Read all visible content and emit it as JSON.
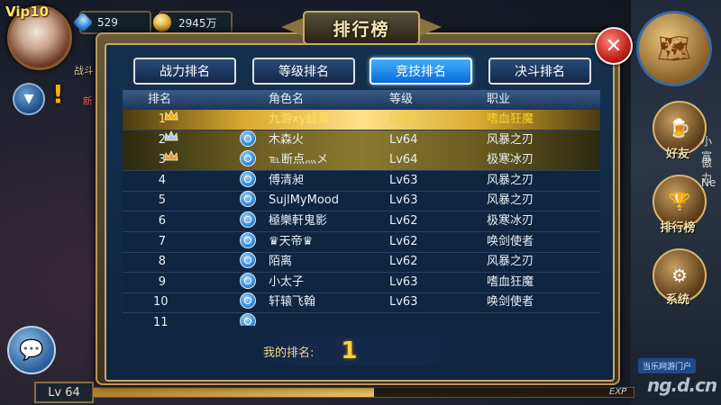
{
  "hud": {
    "vip": "Vip10",
    "diamonds": "529",
    "gold": "2945万",
    "level": "Lv 64",
    "exp_label": "EXP",
    "exp_progress": 0.52,
    "left_texts": [
      "战斗",
      "新"
    ]
  },
  "dialog": {
    "title": "排行榜",
    "tabs": [
      "战力排名",
      "等级排名",
      "竞技排名",
      "决斗排名"
    ],
    "active_tab": 2,
    "columns": [
      "排名",
      "角色名",
      "等级",
      "职业"
    ],
    "rows": [
      {
        "rank": "1",
        "name": "九游xy蛙哥",
        "level": "Lv64",
        "job": "嗜血狂魔"
      },
      {
        "rank": "2",
        "name": "木森火",
        "level": "Lv64",
        "job": "风暴之刃"
      },
      {
        "rank": "3",
        "name": "℡断点灬メ",
        "level": "Lv64",
        "job": "极寒冰刃"
      },
      {
        "rank": "4",
        "name": "傅清昶",
        "level": "Lv63",
        "job": "风暴之刃"
      },
      {
        "rank": "5",
        "name": "SujlMyMood",
        "level": "Lv63",
        "job": "风暴之刃"
      },
      {
        "rank": "6",
        "name": "極樂軒鬼影",
        "level": "Lv62",
        "job": "极寒冰刃"
      },
      {
        "rank": "7",
        "name": "♛天帝♛",
        "level": "Lv62",
        "job": "唤剑使者"
      },
      {
        "rank": "8",
        "name": "陌离",
        "level": "Lv62",
        "job": "风暴之刃"
      },
      {
        "rank": "9",
        "name": "小太子",
        "level": "Lv63",
        "job": "嗜血狂魔"
      },
      {
        "rank": "10",
        "name": "轩辕飞翰",
        "level": "Lv63",
        "job": "唤剑使者"
      },
      {
        "rank": "11",
        "name": "",
        "level": "",
        "job": ""
      }
    ],
    "my_rank_label": "我的排名:",
    "my_rank_value": "1"
  },
  "right_menu": {
    "friends": "好友",
    "ranking": "排行榜",
    "system": "系统",
    "side_texts": [
      "小富",
      "傲力",
      "Ne"
    ]
  },
  "watermark": {
    "tag": "当乐网游门户",
    "site": "ng.d.cn"
  },
  "colors": {
    "active_tab": "#1a8aff",
    "gold_row": "#e8b840",
    "close_button": "#d02a20"
  }
}
